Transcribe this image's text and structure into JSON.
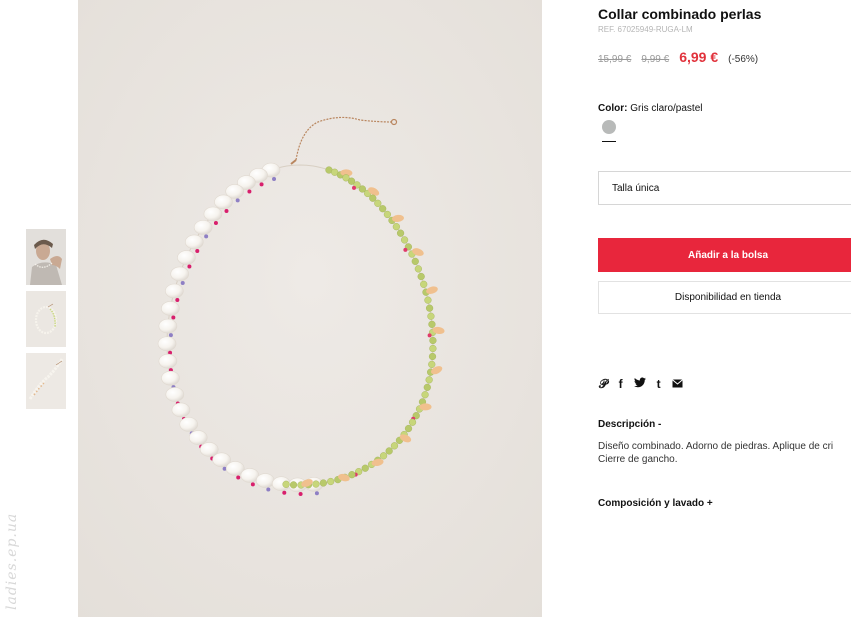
{
  "watermark": "ladies.ep.ua",
  "gallery": {
    "thumbnails": [
      "model wearing necklace",
      "necklace flat view",
      "necklace detail"
    ]
  },
  "product": {
    "title": "Collar combinado perlas",
    "ref": "REF. 67025949-RUGA-LM",
    "prices": {
      "original": "15,99 €",
      "previous": "9,99 €",
      "current": "6,99 €",
      "discount": "(-56%)"
    },
    "color": {
      "label": "Color:",
      "value": "Gris claro/pastel",
      "swatch": "#b8bab9"
    },
    "size_label": "Talla única",
    "add_to_bag": "Añadir a la bolsa",
    "store_availability": "Disponibilidad en tienda",
    "share_icons": [
      "pinterest-icon",
      "facebook-icon",
      "twitter-icon",
      "tumblr-icon",
      "mail-icon"
    ],
    "description": {
      "title": "Descripción -",
      "lines": [
        "Diseño combinado. Adorno de piedras. Aplique de cri",
        "Cierre de gancho."
      ]
    },
    "composition_title": "Composición y lavado +"
  },
  "colors": {
    "accent": "#e8263c",
    "sale_price": "#e1323c",
    "image_background": "#ebe7e2"
  }
}
